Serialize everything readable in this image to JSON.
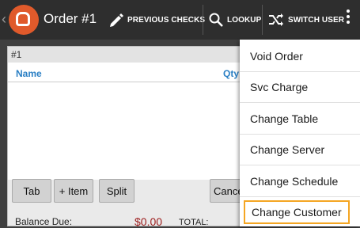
{
  "header": {
    "title": "Order #1",
    "buttons": {
      "previous_checks": "PREVIOUS CHECKS",
      "lookup": "LOOKUP",
      "switch_user": "SWITCH USER"
    }
  },
  "check": {
    "label": "#1",
    "columns": {
      "name": "Name",
      "qty": "Qty"
    },
    "actions": {
      "tab": "Tab",
      "add_item": "+ Item",
      "split": "Split",
      "cancel": "Cance"
    },
    "balance_label": "Balance Due:",
    "balance_value": "$0.00",
    "total_label": "TOTAL:"
  },
  "menu": {
    "items": [
      {
        "label": "Void Order"
      },
      {
        "label": "Svc Charge"
      },
      {
        "label": "Change Table"
      },
      {
        "label": "Change Server"
      },
      {
        "label": "Change Schedule"
      },
      {
        "label": "Change Customer",
        "highlighted": true
      }
    ]
  },
  "colors": {
    "brand": "#e05a2b",
    "highlight": "#f5a623",
    "header_text": "#2a7fc4"
  },
  "icons": [
    "chevron-left-icon",
    "toast-logo-icon",
    "pencil-icon",
    "search-icon",
    "shuffle-icon",
    "more-vert-icon"
  ]
}
